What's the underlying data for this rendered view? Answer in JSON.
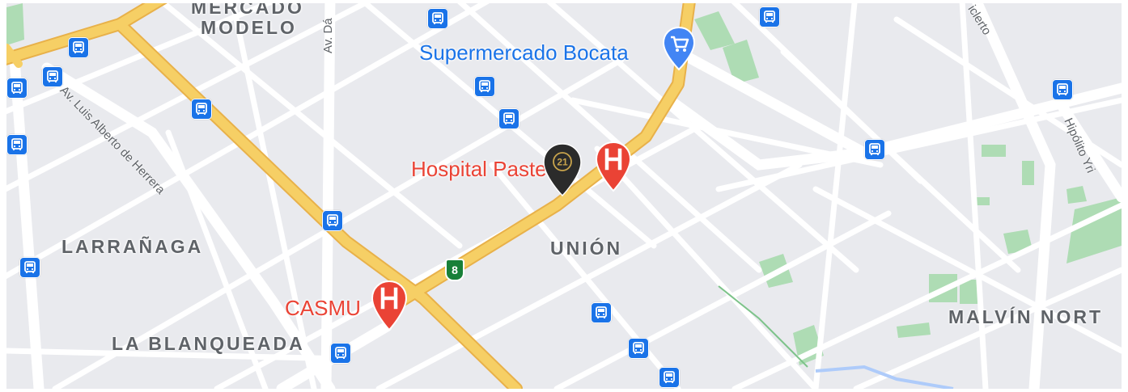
{
  "map": {
    "areas": {
      "mercado_modelo_line1": "MERCADO",
      "mercado_modelo_line2": "MODELO",
      "larranaga": "LARRAÑAGA",
      "union": "UNIÓN",
      "la_blanqueada": "LA BLANQUEADA",
      "malvin_norte": "MALVÍN NORT"
    },
    "streets": {
      "luis_alberto_de_herrera": "Av. Luis Alberto de Herrera",
      "av_da": "Av. Dá",
      "hipolito": "Hipólito Yri",
      "cielo": "iclerto"
    },
    "pois": {
      "supermercado": "Supermercado Bocata",
      "hospital": "Hospital Pasteur",
      "casmu": "CASMU"
    },
    "route_shield": "8",
    "marker_badge": "21",
    "icons": {
      "bus_stop": "bus-icon",
      "hospital": "hospital-icon",
      "shopping": "shopping-cart-icon",
      "marker": "location-pin-icon"
    },
    "colors": {
      "background": "#e9eaee",
      "road": "#ffffff",
      "arterial": "#f6cf65",
      "park": "#aedcb4",
      "transit": "#1a73e8",
      "hospital": "#ea4335",
      "shopping": "#1a73e8",
      "route_shield": "#188038",
      "marker": "#2b2b2b"
    }
  }
}
